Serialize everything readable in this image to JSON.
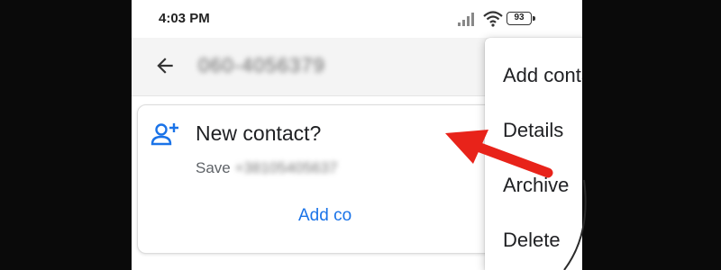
{
  "status_bar": {
    "time": "4:03 PM",
    "battery": "93",
    "icons": [
      "signal-icon",
      "wifi-icon",
      "battery-icon"
    ]
  },
  "app_bar": {
    "back_icon": "arrow-back-icon",
    "phone_number": "060-4056379"
  },
  "card": {
    "icon": "person-add-icon",
    "title": "New contact?",
    "subtitle_prefix": "Save ",
    "subtitle_number": "+38105405637",
    "action_label": "Add co"
  },
  "menu": {
    "items": [
      {
        "label": "Add contact"
      },
      {
        "label": "Details"
      },
      {
        "label": "Archive"
      },
      {
        "label": "Delete"
      }
    ]
  },
  "colors": {
    "accent": "#1a73e8",
    "annotation_arrow": "#e8231a",
    "background": "#0a0a0a"
  }
}
